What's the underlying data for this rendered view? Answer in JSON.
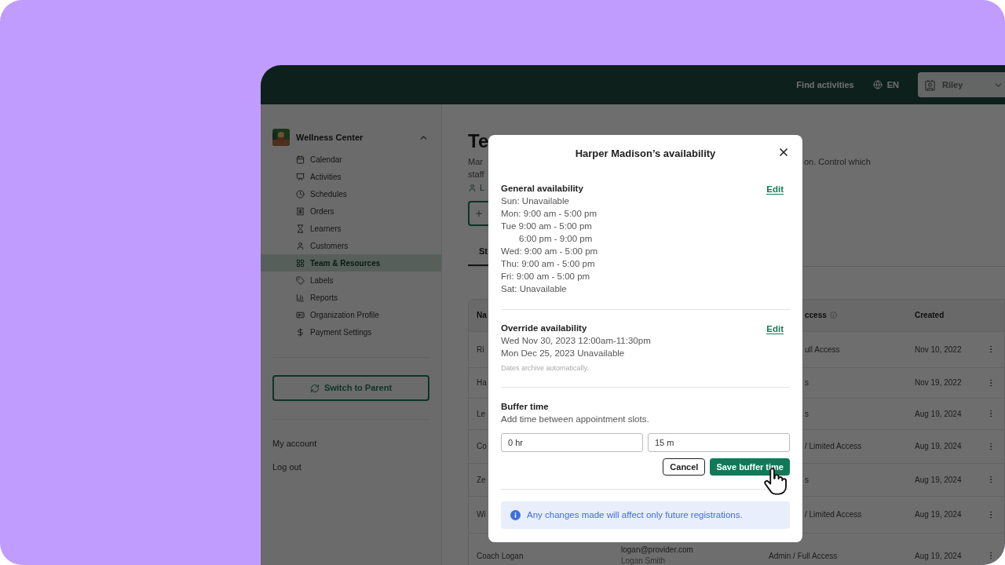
{
  "header": {
    "links": [
      "Find activities"
    ],
    "language": "EN",
    "user": "Riley"
  },
  "sidebar": {
    "org": {
      "name": "Wellness Center",
      "expanded": true
    },
    "items": [
      {
        "label": "Calendar",
        "selected": false
      },
      {
        "label": "Activities",
        "selected": false
      },
      {
        "label": "Schedules",
        "selected": false
      },
      {
        "label": "Orders",
        "selected": false
      },
      {
        "label": "Learners",
        "selected": false
      },
      {
        "label": "Customers",
        "selected": false
      },
      {
        "label": "Team & Resources",
        "selected": true
      },
      {
        "label": "Labels",
        "selected": false
      },
      {
        "label": "Reports",
        "selected": false
      },
      {
        "label": "Organization Profile",
        "selected": false
      },
      {
        "label": "Payment Settings",
        "selected": false
      }
    ],
    "switch_button": "Switch to Parent",
    "account_links": [
      "My account",
      "Log out"
    ]
  },
  "page": {
    "title": "Te",
    "description_left": [
      "Mar",
      "staff"
    ],
    "description_right": "on. Control which",
    "link": "L",
    "tabs": [
      {
        "label": "St",
        "selected": true
      }
    ],
    "table": {
      "columns": [
        "Na",
        "ccess",
        "Created"
      ],
      "rows": [
        {
          "name": "Ri",
          "access": "ull Access",
          "created": "Nov 10, 2022"
        },
        {
          "name": "Ha",
          "access": "s",
          "created": "Nov 19, 2022"
        },
        {
          "name": "Le",
          "access": "s",
          "created": "Aug 19, 2024"
        },
        {
          "name": "Co",
          "access": "/ Limited Access",
          "created": "Aug 19, 2024"
        },
        {
          "name": "Ze",
          "access": "s",
          "created": "Aug 19, 2024"
        },
        {
          "name": "Wi",
          "access": "/ Limited Access",
          "created": "Aug 19, 2024"
        },
        {
          "name": "Coach Logan",
          "email": "logan@provider.com",
          "contact": "Logan Smith",
          "access": "Admin / Full Access",
          "created": "Aug 19, 2024"
        }
      ]
    }
  },
  "modal": {
    "title": "Harper Madison’s availability",
    "general": {
      "heading": "General availability",
      "edit": "Edit",
      "lines": [
        {
          "text": "Sun: Unavailable",
          "kind": "day"
        },
        {
          "text": "Mon: 9:00 am - 5:00 pm",
          "kind": "day"
        },
        {
          "text": "Tue 9:00 am - 5:00 pm",
          "kind": "day"
        },
        {
          "text": "6:00 pm - 9:00 pm",
          "kind": "continuation"
        },
        {
          "text": "Wed: 9:00 am - 5:00 pm",
          "kind": "day"
        },
        {
          "text": "Thu: 9:00 am - 5:00 pm",
          "kind": "day"
        },
        {
          "text": "Fri: 9:00 am - 5:00 pm",
          "kind": "day"
        },
        {
          "text": "Sat: Unavailable",
          "kind": "day"
        }
      ]
    },
    "override": {
      "heading": "Override availability",
      "edit": "Edit",
      "lines": [
        "Wed Nov 30, 2023 12:00am-11:30pm",
        "Mon Dec 25, 2023 Unavailable"
      ],
      "note": "Dates archive automatically."
    },
    "buffer": {
      "heading": "Buffer time",
      "subtitle": "Add time between appointment slots.",
      "hours": "0 hr",
      "minutes": "15 m",
      "cancel": "Cancel",
      "save": "Save buffer time"
    },
    "notice": "Any changes made will affect only future registrations."
  }
}
